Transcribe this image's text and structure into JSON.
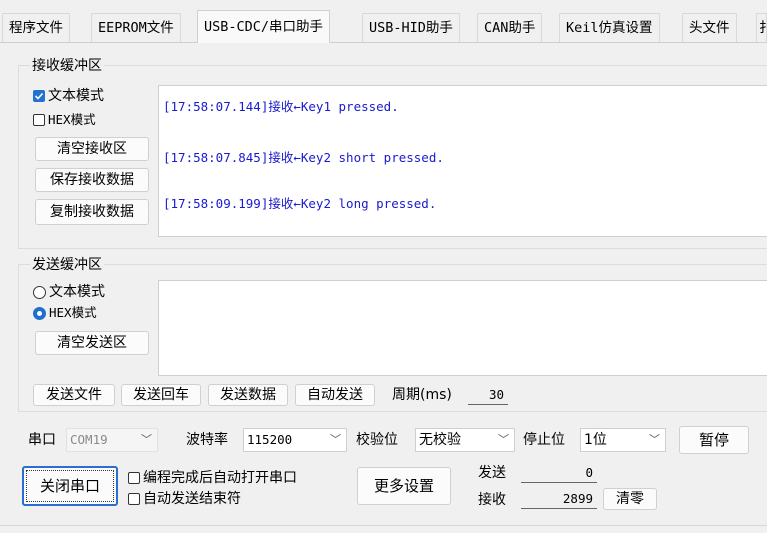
{
  "tabs": [
    {
      "label": "程序文件"
    },
    {
      "label": "EEPROM文件"
    },
    {
      "label": "USB-CDC/串口助手"
    },
    {
      "label": "USB-HID助手"
    },
    {
      "label": "CAN助手"
    },
    {
      "label": "Keil仿真设置"
    },
    {
      "label": "头文件"
    },
    {
      "label": "扌"
    }
  ],
  "receive": {
    "title": "接收缓冲区",
    "text_mode": "文本模式",
    "hex_mode": "HEX模式",
    "clear_btn": "清空接收区",
    "save_btn": "保存接收数据",
    "copy_btn": "复制接收数据",
    "lines": [
      "[17:58:07.144]接收←Key1 pressed.",
      "[17:58:07.845]接收←Key2 short pressed.",
      "[17:58:09.199]接收←Key2 long pressed."
    ]
  },
  "send": {
    "title": "发送缓冲区",
    "text_mode": "文本模式",
    "hex_mode": "HEX模式",
    "clear_btn": "清空发送区",
    "send_file_btn": "发送文件",
    "send_enter_btn": "发送回车",
    "send_data_btn": "发送数据",
    "auto_send_btn": "自动发送",
    "period_label": "周期(ms)",
    "period_value": "30"
  },
  "port": {
    "port_label": "串口",
    "port_value": "COM19",
    "baud_label": "波特率",
    "baud_value": "115200",
    "parity_label": "校验位",
    "parity_value": "无校验",
    "stop_label": "停止位",
    "stop_value": "1位",
    "pause_btn": "暂停",
    "close_btn": "关闭串口",
    "auto_open": "编程完成后自动打开串口",
    "auto_send_end": "自动发送结束符",
    "more_btn": "更多设置",
    "sent_label": "发送",
    "sent_value": "0",
    "recv_label": "接收",
    "recv_value": "2899",
    "reset_btn": "清零"
  },
  "colors": {
    "accent": "#2272d0",
    "received_text": "#1a1ad0"
  }
}
